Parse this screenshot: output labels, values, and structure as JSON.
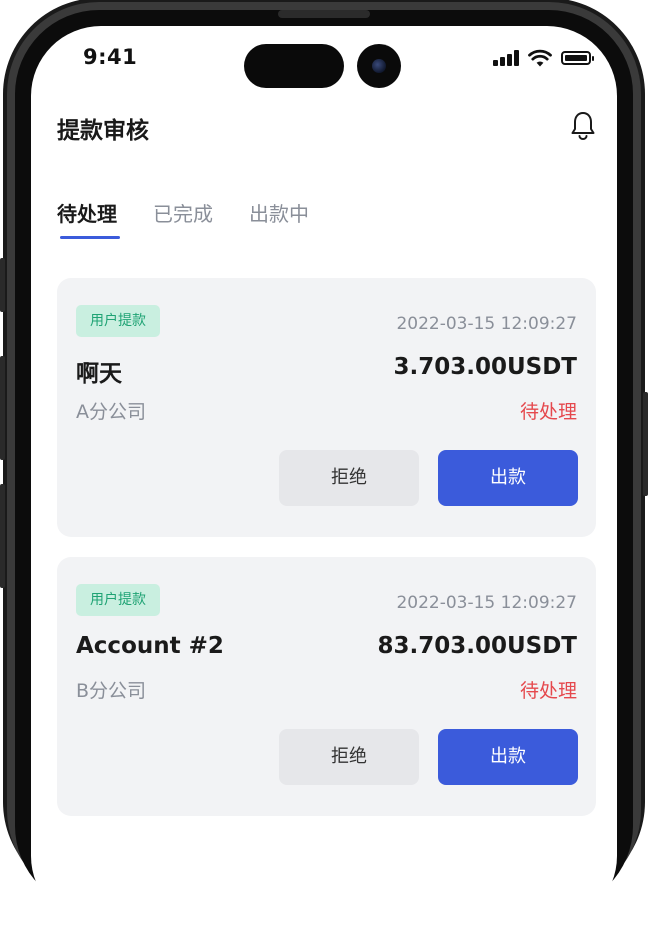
{
  "status_bar": {
    "time": "9:41"
  },
  "header": {
    "title": "提款审核",
    "bell_icon": "bell-icon"
  },
  "tabs": [
    {
      "label": "待处理",
      "active": true
    },
    {
      "label": "已完成",
      "active": false
    },
    {
      "label": "出款中",
      "active": false
    }
  ],
  "colors": {
    "accent": "#3b5bdb",
    "status_pending": "#e5484d",
    "badge_bg": "#c9efe0",
    "badge_text": "#1fa374"
  },
  "withdrawals": [
    {
      "badge": "用户提款",
      "datetime": "2022-03-15 12:09:27",
      "account": "啊天",
      "amount": "3.703.00USDT",
      "branch": "A分公司",
      "status": "待处理",
      "reject_label": "拒绝",
      "payout_label": "出款"
    },
    {
      "badge": "用户提款",
      "datetime": "2022-03-15 12:09:27",
      "account": "Account #2",
      "amount": "83.703.00USDT",
      "branch": "B分公司",
      "status": "待处理",
      "reject_label": "拒绝",
      "payout_label": "出款"
    }
  ]
}
